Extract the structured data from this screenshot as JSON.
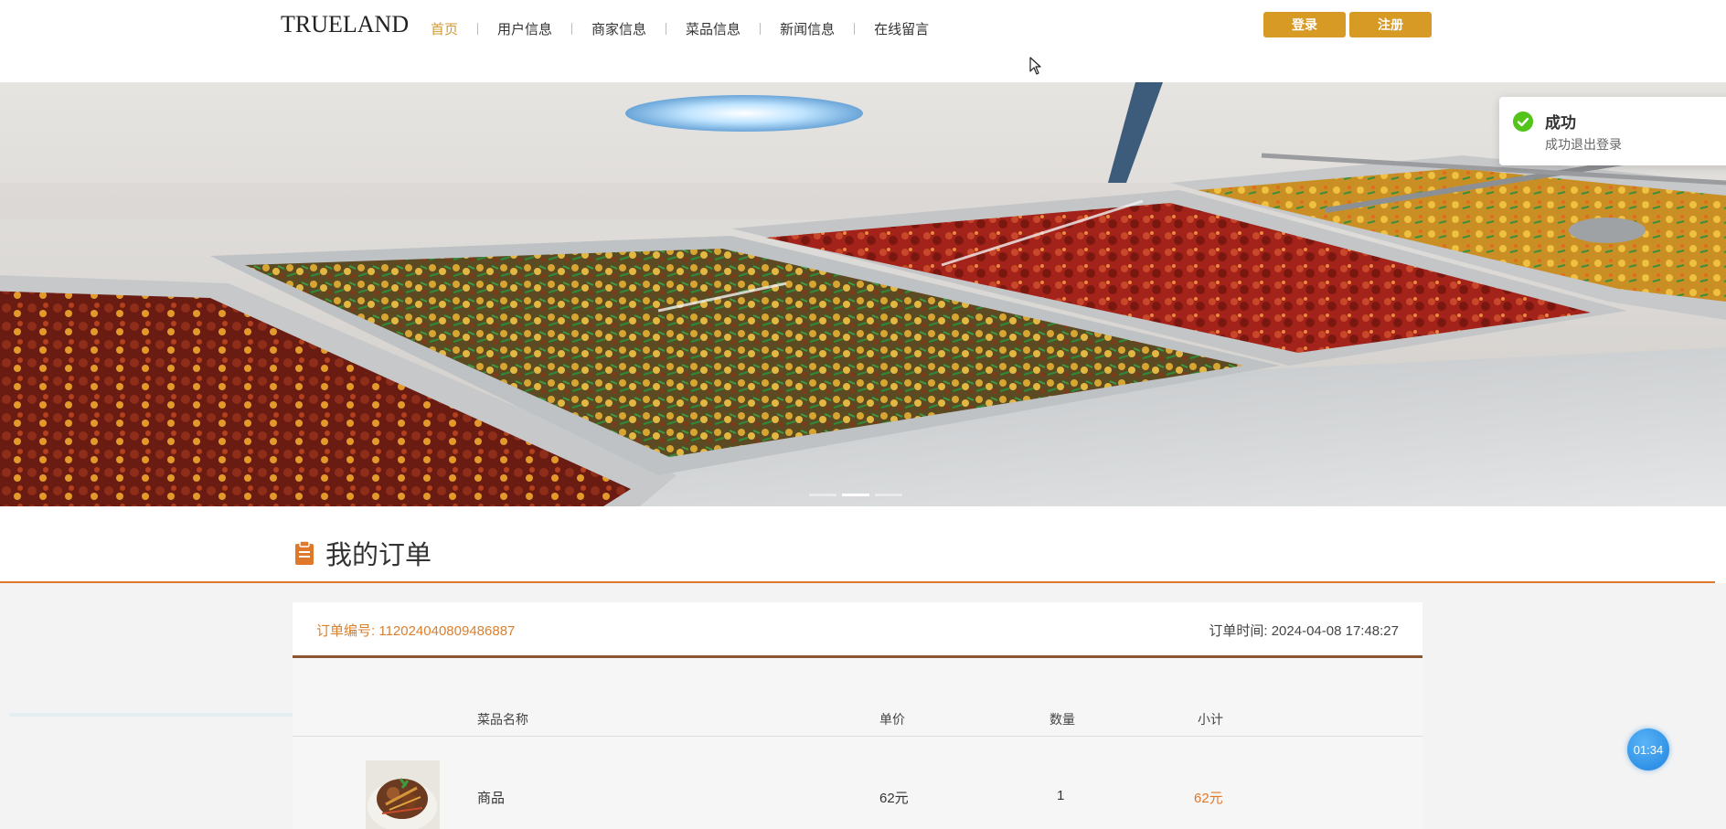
{
  "header": {
    "logo_text": "TRUELAND",
    "nav_items": [
      {
        "label": "首页",
        "active": true
      },
      {
        "label": "用户信息",
        "active": false
      },
      {
        "label": "商家信息",
        "active": false
      },
      {
        "label": "菜品信息",
        "active": false
      },
      {
        "label": "新闻信息",
        "active": false
      },
      {
        "label": "在线留言",
        "active": false
      }
    ],
    "login_label": "登录",
    "register_label": "注册"
  },
  "banner": {
    "image_icon": "food-buffet-image",
    "slide_count": 3,
    "active_slide": 2
  },
  "toast": {
    "title": "成功",
    "message": "成功退出登录",
    "icon": "check-circle-icon",
    "color": "#52c41a"
  },
  "orders": {
    "section_title": "我的订单",
    "section_icon": "clipboard-icon",
    "order_no_label": "订单编号: 112024040809486887",
    "order_time_label": "订单时间: 2024-04-08 17:48:27",
    "columns": [
      "菜品名称",
      "单价",
      "数量",
      "小计"
    ],
    "items": [
      {
        "name": "商品",
        "unit_price": "62元",
        "quantity": "1",
        "subtotal": "62元"
      }
    ]
  },
  "timer": {
    "text": "01:34"
  },
  "colors": {
    "accent": "#d69a25",
    "orange": "#e0782b",
    "success": "#52c41a"
  }
}
